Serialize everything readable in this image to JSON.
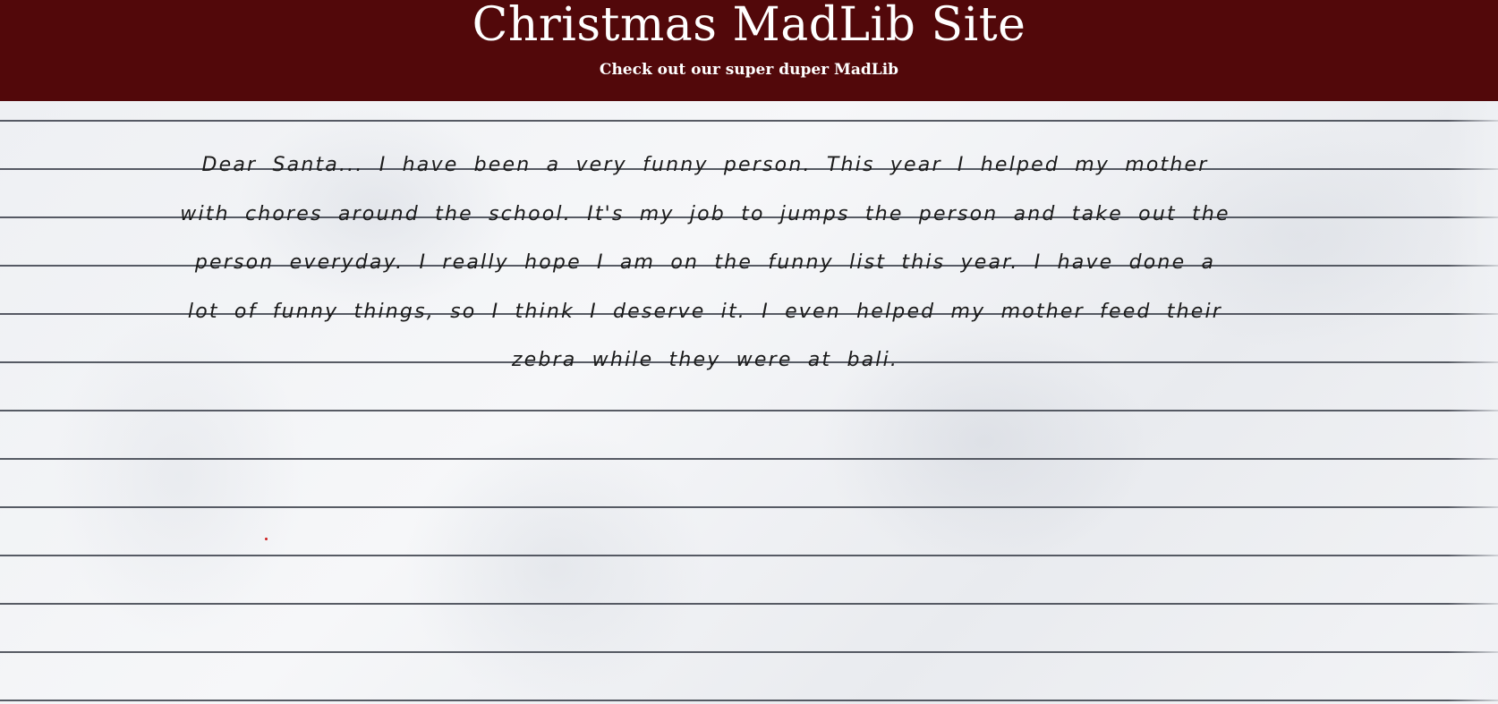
{
  "header": {
    "title": "Christmas MadLib Site",
    "subtitle": "Check out our super duper MadLib"
  },
  "story": {
    "text": "Dear Santa... I have been a very funny person. This year I helped my mother with chores around the school. It's my job to jumps the person and take out the person everyday. I really hope I am on the funny list this year. I have done a lot of funny things, so I think I deserve it. I even helped my mother feed their zebra while they were at bali."
  },
  "colors": {
    "header_bg": "#52080a",
    "header_text": "#ffffff",
    "paper_lines": "#3b3f4a",
    "story_text": "#1a1a1a"
  }
}
